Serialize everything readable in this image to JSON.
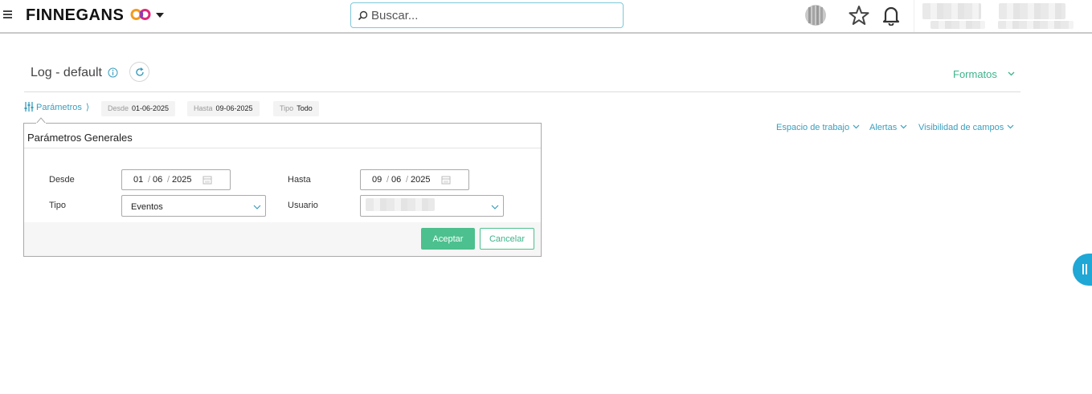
{
  "topbar": {
    "brand": "FINNEGANS",
    "search_placeholder": "Buscar..."
  },
  "header": {
    "title": "Log - default",
    "formatos_label": "Formatos"
  },
  "params": {
    "link_label": "Parámetros",
    "chips": [
      {
        "key": "Desde",
        "value": "01-06-2025"
      },
      {
        "key": "Hasta",
        "value": "09-06-2025"
      },
      {
        "key": "Tipo",
        "value": "Todo"
      }
    ]
  },
  "toolbar": {
    "espacio": "Espacio de trabajo",
    "alertas": "Alertas",
    "visibilidad": "Visibilidad de campos"
  },
  "panel": {
    "title": "Parámetros Generales",
    "desde_label": "Desde",
    "desde": {
      "day": "01",
      "month": "06",
      "year": "2025"
    },
    "hasta_label": "Hasta",
    "hasta": {
      "day": "09",
      "month": "06",
      "year": "2025"
    },
    "tipo_label": "Tipo",
    "tipo_value": "Eventos",
    "usuario_label": "Usuario",
    "accept": "Aceptar",
    "cancel": "Cancelar"
  },
  "colors": {
    "accent_green": "#4cc08e",
    "link_blue": "#3a9dbd",
    "handle_blue": "#1fa7d6"
  }
}
